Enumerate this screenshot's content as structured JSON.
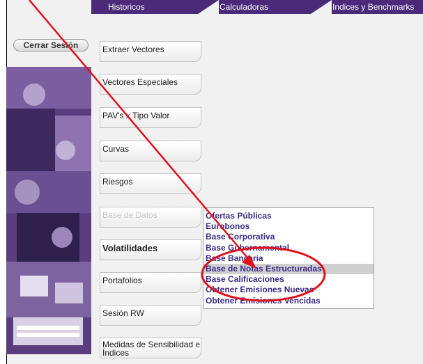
{
  "nav": {
    "tabs": [
      "Historicos",
      "Calculadoras",
      "Indices y Benchmarks"
    ]
  },
  "logout_label": "Cerrar Sesión",
  "menu": [
    "Extraer Vectores",
    "Vectores Especiales",
    "PAV's x Tipo Valor",
    "Curvas",
    "Riesgos",
    "Base de Datos",
    "Volatilidades",
    "Portafolios",
    "Sesión RW",
    "Medidas de Sensibilidad e Índices"
  ],
  "submenu": [
    "Ofertas Públicas",
    "Eurobonos",
    "Base Corporativa",
    "Base Gubernamental",
    "Base Bancaria",
    "Base de Notas Estructuradas",
    "Base Calificaciones",
    "Obtener Emisiones Nuevas",
    "Obtener Emisiones Vencidas"
  ],
  "colors": {
    "topbar": "#4b2a7a",
    "submenu_text": "#3b2a8a",
    "annotation": "#e0101a"
  }
}
